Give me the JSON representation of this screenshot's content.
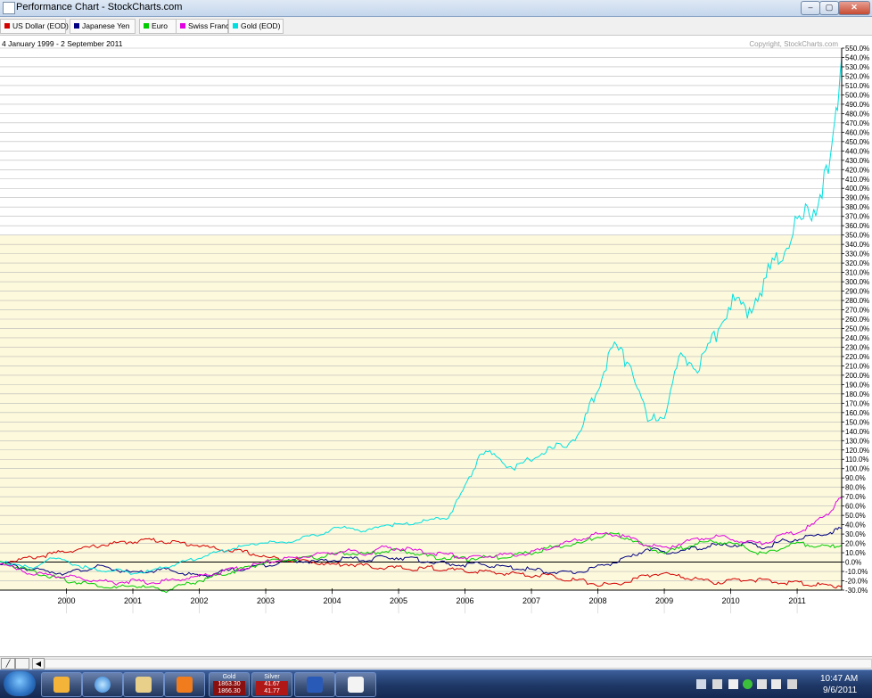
{
  "window": {
    "title": "Performance Chart - StockCharts.com",
    "buttons": {
      "minimize": "–",
      "maximize": "▢",
      "close": "✕"
    }
  },
  "legend": [
    {
      "label": "US Dollar (EOD)",
      "color": "#d40000"
    },
    {
      "label": "Japanese Yen",
      "color": "#000080"
    },
    {
      "label": "Euro",
      "color": "#00cc00"
    },
    {
      "label": "Swiss Franc",
      "color": "#e000e0"
    },
    {
      "label": "Gold (EOD)",
      "color": "#00e0e0"
    }
  ],
  "chart_data": {
    "type": "line",
    "title": "4 January 1999 - 2 September 2011",
    "copyright": "Copyright, StockCharts.com",
    "xlabel": "",
    "ylabel": "",
    "x_tick_labels": [
      "2000",
      "2001",
      "2002",
      "2003",
      "2004",
      "2005",
      "2006",
      "2007",
      "2008",
      "2009",
      "2010",
      "2011"
    ],
    "xlim": [
      1999.0,
      2011.67
    ],
    "ylim": [
      -30,
      550
    ],
    "y_tick_step": 10,
    "y_tick_format": "%",
    "grid": true,
    "zero_line": true,
    "legend_position": "top",
    "x": [
      1999.0,
      1999.25,
      1999.5,
      1999.75,
      2000.0,
      2000.25,
      2000.5,
      2000.75,
      2001.0,
      2001.25,
      2001.5,
      2001.75,
      2002.0,
      2002.25,
      2002.5,
      2002.75,
      2003.0,
      2003.25,
      2003.5,
      2003.75,
      2004.0,
      2004.25,
      2004.5,
      2004.75,
      2005.0,
      2005.25,
      2005.5,
      2005.75,
      2006.0,
      2006.25,
      2006.5,
      2006.75,
      2007.0,
      2007.25,
      2007.5,
      2007.75,
      2008.0,
      2008.25,
      2008.5,
      2008.75,
      2009.0,
      2009.25,
      2009.5,
      2009.75,
      2010.0,
      2010.25,
      2010.5,
      2010.75,
      2011.0,
      2011.25,
      2011.5,
      2011.67
    ],
    "series": [
      {
        "name": "US Dollar (EOD)",
        "color": "#d40000",
        "values": [
          0,
          2,
          5,
          8,
          12,
          14,
          18,
          20,
          22,
          24,
          22,
          20,
          18,
          14,
          12,
          10,
          5,
          3,
          2,
          0,
          -3,
          -2,
          -4,
          -6,
          -6,
          -8,
          -6,
          -8,
          -10,
          -10,
          -12,
          -12,
          -14,
          -14,
          -18,
          -20,
          -24,
          -24,
          -20,
          -14,
          -12,
          -16,
          -18,
          -22,
          -20,
          -18,
          -20,
          -22,
          -22,
          -24,
          -26,
          -25
        ]
      },
      {
        "name": "Japanese Yen",
        "color": "#000080",
        "values": [
          0,
          -5,
          -8,
          -10,
          -12,
          -8,
          -5,
          -8,
          -12,
          -10,
          -8,
          -12,
          -15,
          -12,
          -8,
          -6,
          -3,
          0,
          2,
          0,
          2,
          4,
          2,
          5,
          5,
          3,
          0,
          -2,
          -3,
          -2,
          -5,
          -6,
          -8,
          -10,
          -12,
          -10,
          -5,
          0,
          5,
          15,
          10,
          12,
          15,
          18,
          18,
          20,
          15,
          22,
          25,
          28,
          32,
          36
        ]
      },
      {
        "name": "Euro",
        "color": "#00cc00",
        "values": [
          0,
          -5,
          -10,
          -15,
          -20,
          -22,
          -25,
          -28,
          -25,
          -28,
          -30,
          -25,
          -20,
          -15,
          -10,
          -5,
          0,
          2,
          3,
          5,
          8,
          10,
          8,
          12,
          12,
          10,
          5,
          5,
          3,
          5,
          5,
          8,
          10,
          15,
          18,
          20,
          28,
          30,
          25,
          15,
          10,
          15,
          20,
          22,
          20,
          15,
          8,
          15,
          20,
          18,
          16,
          18
        ]
      },
      {
        "name": "Swiss Franc",
        "color": "#e000e0",
        "values": [
          0,
          -8,
          -12,
          -15,
          -15,
          -18,
          -20,
          -22,
          -20,
          -22,
          -20,
          -18,
          -15,
          -12,
          -8,
          -5,
          0,
          3,
          5,
          8,
          10,
          12,
          8,
          15,
          15,
          12,
          10,
          8,
          5,
          5,
          8,
          8,
          10,
          15,
          20,
          25,
          30,
          30,
          25,
          18,
          15,
          20,
          25,
          28,
          25,
          22,
          20,
          28,
          32,
          40,
          55,
          70
        ]
      },
      {
        "name": "Gold (EOD)",
        "color": "#00e0e0",
        "values": [
          0,
          -2,
          -8,
          5,
          0,
          -5,
          -10,
          -8,
          -12,
          -10,
          -5,
          0,
          5,
          10,
          15,
          18,
          22,
          20,
          25,
          28,
          35,
          38,
          32,
          40,
          40,
          42,
          45,
          48,
          80,
          120,
          110,
          100,
          110,
          120,
          125,
          140,
          190,
          230,
          210,
          150,
          160,
          220,
          210,
          240,
          280,
          270,
          300,
          330,
          360,
          380,
          420,
          540
        ]
      }
    ]
  },
  "taskbar": {
    "gold_widget": {
      "label": "Gold",
      "v1": "1863.30",
      "v2": "1866.30"
    },
    "silver_widget": {
      "label": "Silver",
      "v1": "41.67",
      "v2": "41.77"
    },
    "clock_time": "10:47 AM",
    "clock_date": "9/6/2011"
  }
}
